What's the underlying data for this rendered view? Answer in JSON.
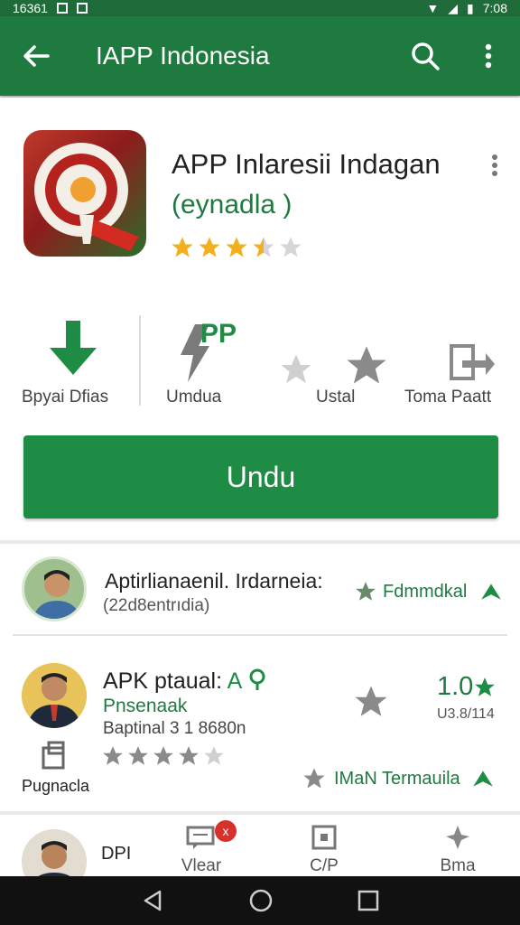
{
  "status_bar": {
    "left_text": "16361",
    "right_text": "7:08"
  },
  "app_bar": {
    "title": "IAPP Indonesia"
  },
  "app": {
    "name": "APP Inlaresii Indagan",
    "developer": "(eynadla )",
    "rating_stars": 3.5
  },
  "stats": [
    {
      "label": "Bpyai Dfias",
      "icon": "download-icon"
    },
    {
      "label": "Umdua",
      "icon": "pp-badge-icon",
      "badge": "PP"
    },
    {
      "label": "Ustal",
      "icon": "star-icon"
    },
    {
      "label": "Toma Paatt",
      "icon": "share-icon"
    }
  ],
  "install_button": {
    "label": "Undu"
  },
  "reviews": [
    {
      "title": "Aptirlianaenil. Irdarneia:",
      "subtitle": "(22d8entrıdia)",
      "action_label": "Fdmmdkal"
    },
    {
      "title_prefix": "APK ptaual:",
      "title_suffix": "A",
      "subtitle_green": "Pnsenaak",
      "meta": "Baptinal 3 1 8680n",
      "score": "1.0",
      "score_sub": "U3.8/114",
      "left_label": "Pugnacla",
      "rating_stars": 4,
      "footer_label": "IMaN Termauila"
    },
    {
      "title": "DPI"
    }
  ],
  "bottom_tabs": [
    {
      "label": "Vlear",
      "icon": "chat-icon",
      "badge": "x"
    },
    {
      "label": "C/P",
      "icon": "card-icon"
    },
    {
      "label": "Bma",
      "icon": "pin-icon"
    }
  ],
  "colors": {
    "primary": "#1f7a40",
    "accent": "#1f8c45",
    "star": "#f2b01e"
  }
}
